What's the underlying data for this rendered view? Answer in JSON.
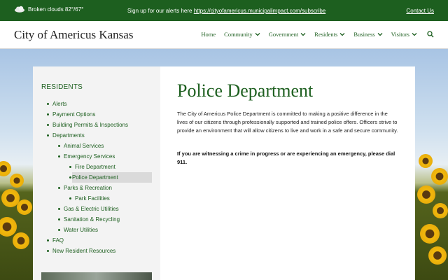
{
  "topbar": {
    "weather_icon": "cloud-icon",
    "weather_text": "Broken clouds 82°/67°",
    "signup_text": "Sign up for our alerts here",
    "signup_link": "https://cityofamericus.municipalimpact.com/subscribe",
    "contact_label": "Contact Us"
  },
  "header": {
    "site_title": "City of Americus Kansas",
    "nav": {
      "home": "Home",
      "community": "Community",
      "government": "Government",
      "residents": "Residents",
      "business": "Business",
      "visitors": "Visitors"
    },
    "search_icon": "search-icon"
  },
  "sidebar": {
    "heading": "RESIDENTS",
    "items": [
      {
        "label": "Alerts",
        "level": 0
      },
      {
        "label": "Payment Options",
        "level": 0
      },
      {
        "label": "Building Permits & Inspections",
        "level": 0
      },
      {
        "label": "Departments",
        "level": 0
      },
      {
        "label": "Animal Services",
        "level": 1
      },
      {
        "label": "Emergency Services",
        "level": 1
      },
      {
        "label": "Fire Department",
        "level": 2
      },
      {
        "label": "Police Department",
        "level": 2,
        "active": true
      },
      {
        "label": "Parks & Recreation",
        "level": 1
      },
      {
        "label": "Park Facilities",
        "level": 2
      },
      {
        "label": "Gas & Electric Utilities",
        "level": 1
      },
      {
        "label": "Sanitation & Recycling",
        "level": 1
      },
      {
        "label": "Water Utilities",
        "level": 1
      },
      {
        "label": "FAQ",
        "level": 0
      },
      {
        "label": "New Resident Resources",
        "level": 0
      }
    ]
  },
  "main": {
    "title": "Police Department",
    "intro": "The City of Americus Police Department is committed to making a positive difference in the lives of our citizens through professionally supported and trained police offers. Officers strive to provide an environment that will allow citizens to live and work in a safe and secure community.",
    "alert": "If you are witnessing a crime in progress or are experiencing an emergency, please dial 911."
  },
  "colors": {
    "brand_green": "#1d5f1f",
    "sidebar_bg": "#f3f3f3",
    "active_item_bg": "#dadada"
  }
}
